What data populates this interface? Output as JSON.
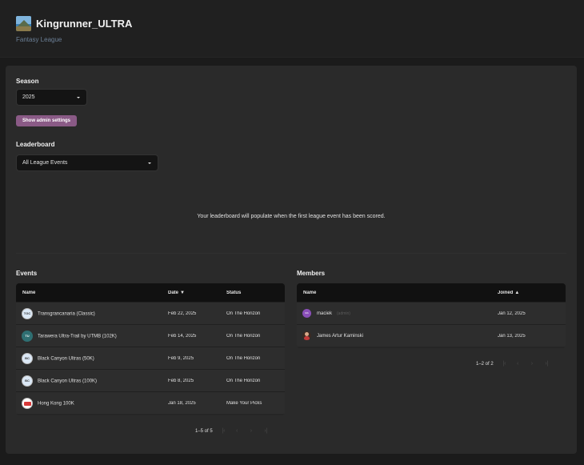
{
  "app": {
    "title": "Kingrunner_ULTRA",
    "subtitle": "Fantasy League",
    "logo_icon": "league-logo-mountain"
  },
  "season": {
    "label": "Season",
    "value": "2025"
  },
  "admin_button": {
    "label": "Show admin settings"
  },
  "leaderboard": {
    "label": "Leaderboard",
    "filter_value": "All League Events",
    "empty_message": "Your leaderboard will populate when the first league event has been scored."
  },
  "events": {
    "title": "Events",
    "columns": {
      "name": "Name",
      "date": "Date",
      "status": "Status"
    },
    "date_sort": "▼",
    "rows": [
      {
        "name": "Transgrancanaria (Classic)",
        "date": "Feb 22, 2025",
        "status": "On The Horizon",
        "icon": "transgrancanaria-logo"
      },
      {
        "name": "Tarawera Ultra-Trail by UTMB (102K)",
        "date": "Feb 14, 2025",
        "status": "On The Horizon",
        "icon": "tarawera-logo"
      },
      {
        "name": "Black Canyon Ultras (50K)",
        "date": "Feb 9, 2025",
        "status": "On The Horizon",
        "icon": "black-canyon-logo"
      },
      {
        "name": "Black Canyon Ultras (100K)",
        "date": "Feb 8, 2025",
        "status": "On The Horizon",
        "icon": "black-canyon-logo"
      },
      {
        "name": "Hong Kong 100K",
        "date": "Jan 18, 2025",
        "status": "Make Your Picks",
        "icon": "hong-kong-logo"
      }
    ],
    "pagination": "1–5 of 5"
  },
  "members": {
    "title": "Members",
    "columns": {
      "name": "Name",
      "joined": "Joined"
    },
    "joined_sort": "▲",
    "rows": [
      {
        "name": "maciek",
        "tag": "(admin)",
        "joined": "Jan 12, 2025",
        "avatar": "initials-avatar"
      },
      {
        "name": "James Artur Kaminski",
        "tag": "",
        "joined": "Jan 13, 2025",
        "avatar": "photo-avatar"
      }
    ],
    "pagination": "1–2 of 2"
  }
}
